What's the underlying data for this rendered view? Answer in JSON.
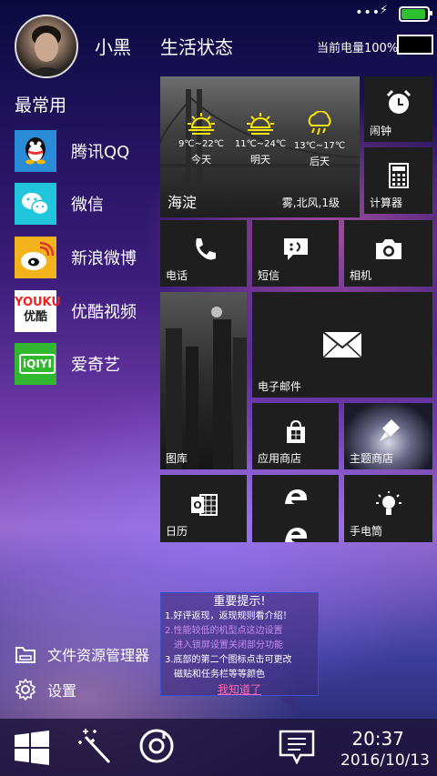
{
  "header": {
    "username": "小黑",
    "status_title": "生活状态",
    "battery_label": "当前电量100%"
  },
  "status_bar": {
    "dots": "•••",
    "battery_level": 1.0
  },
  "left": {
    "frequent_title": "最常用",
    "apps": [
      {
        "label": "腾讯QQ",
        "icon": "qq-icon"
      },
      {
        "label": "微信",
        "icon": "wechat-icon"
      },
      {
        "label": "新浪微博",
        "icon": "weibo-icon"
      },
      {
        "label": "优酷视频",
        "icon": "youku-icon",
        "logo_top": "YOUKU",
        "logo_bottom": "优酷"
      },
      {
        "label": "爱奇艺",
        "icon": "iqiyi-icon",
        "logo": "iQIYI"
      }
    ],
    "file_manager": "文件资源管理器",
    "settings": "设置"
  },
  "weather": {
    "days": [
      {
        "temp": "9℃~22℃",
        "day": "今天",
        "icon": "sun-icon"
      },
      {
        "temp": "11℃~24℃",
        "day": "明天",
        "icon": "sun-icon"
      },
      {
        "temp": "13℃~17℃",
        "day": "后天",
        "icon": "rain-icon"
      }
    ],
    "city": "海淀",
    "condition": "雾,北风,1级"
  },
  "tiles": {
    "alarm": "闹钟",
    "calculator": "计算器",
    "phone": "电话",
    "sms": "短信",
    "camera": "相机",
    "gallery": "图库",
    "email": "电子邮件",
    "store": "应用商店",
    "theme_store": "主题商店",
    "calendar": "日历",
    "flashlight": "手电筒"
  },
  "tip": {
    "title": "重要提示!",
    "line1": "1.好评返现，返现规则看介绍！",
    "line2": "2.性能较低的机型点这边设置",
    "line2b": "进入锁屏设置关闭部分功能",
    "line3": "3.底部的第二个图标点击可更改",
    "line3b": "磁贴和任务栏等等颜色",
    "ok": "我知道了"
  },
  "taskbar": {
    "time": "20:37",
    "date": "2016/10/13"
  },
  "colors": {
    "tile_bg": "#1e1e1e",
    "battery_green": "#2ec02e"
  }
}
